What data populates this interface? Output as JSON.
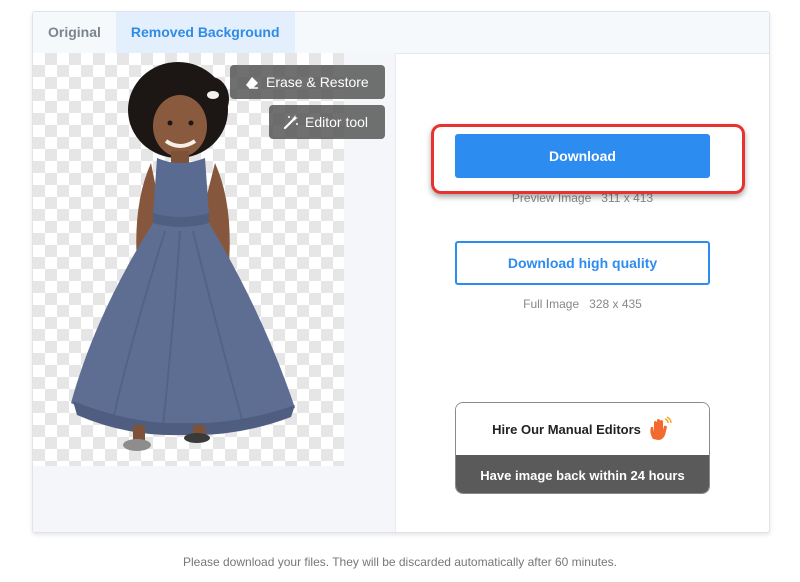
{
  "tabs": [
    {
      "label": "Original",
      "active": false
    },
    {
      "label": "Removed Background",
      "active": true
    }
  ],
  "tools": {
    "erase_label": "Erase & Restore",
    "erase_icon": "eraser-icon",
    "editor_label": "Editor tool",
    "editor_icon": "magic-wand-icon"
  },
  "download": {
    "label": "Download",
    "preview_info": "Preview Image   311 x 413"
  },
  "download_hq": {
    "label": "Download high quality",
    "full_info": "Full Image   328 x 435"
  },
  "hire": {
    "title": "Hire Our Manual Editors",
    "icon": "waving-hand-icon",
    "subtitle": "Have image back within 24 hours"
  },
  "footer": {
    "note": "Please download your files. They will be discarded automatically after 60 minutes."
  },
  "colors": {
    "accent": "#2d8cf0",
    "highlight": "#e8322f",
    "dress": "#5e6e93"
  }
}
